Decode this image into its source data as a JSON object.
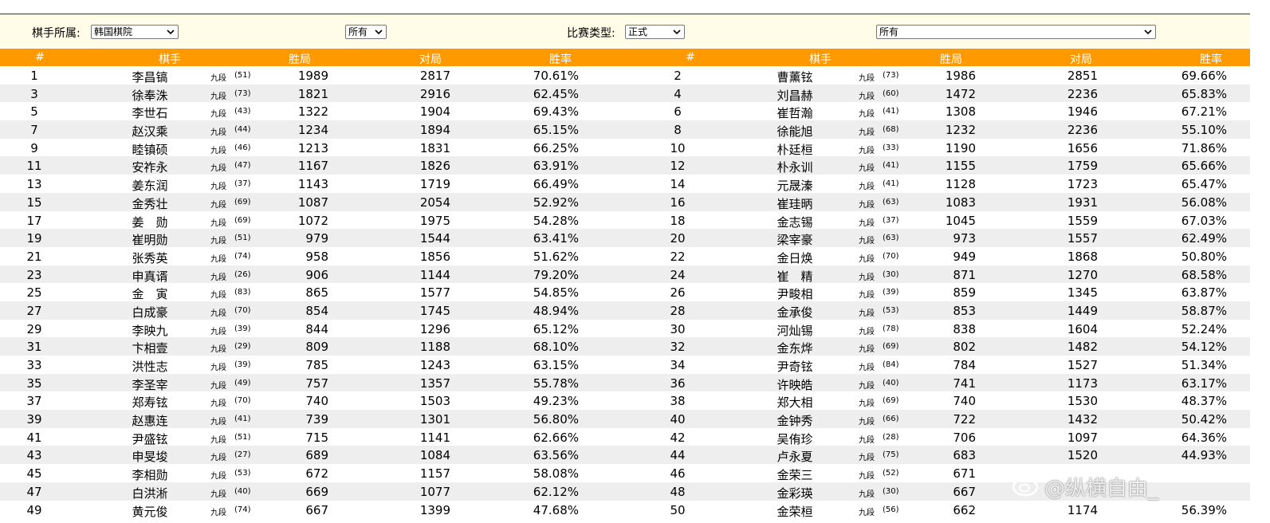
{
  "filters": {
    "affiliation_label": "棋手所属:",
    "affiliation_value": "韩国棋院",
    "second_value": "所有",
    "match_type_label": "比赛类型:",
    "match_type_value": "正式",
    "fourth_value": "所有"
  },
  "columns": [
    "#",
    "棋手",
    "胜局",
    "对局",
    "胜率"
  ],
  "players": [
    {
      "n": "1",
      "name": "李昌镐",
      "rank": "九段",
      "games": "(51)",
      "wins": "1989",
      "total": "2817",
      "rate": "70.61%"
    },
    {
      "n": "2",
      "name": "曹薰铉",
      "rank": "九段",
      "games": "(73)",
      "wins": "1986",
      "total": "2851",
      "rate": "69.66%"
    },
    {
      "n": "3",
      "name": "徐奉洙",
      "rank": "九段",
      "games": "(73)",
      "wins": "1821",
      "total": "2916",
      "rate": "62.45%"
    },
    {
      "n": "4",
      "name": "刘昌赫",
      "rank": "九段",
      "games": "(60)",
      "wins": "1472",
      "total": "2236",
      "rate": "65.83%"
    },
    {
      "n": "5",
      "name": "李世石",
      "rank": "九段",
      "games": "(43)",
      "wins": "1322",
      "total": "1904",
      "rate": "69.43%"
    },
    {
      "n": "6",
      "name": "崔哲瀚",
      "rank": "九段",
      "games": "(41)",
      "wins": "1308",
      "total": "1946",
      "rate": "67.21%"
    },
    {
      "n": "7",
      "name": "赵汉乘",
      "rank": "九段",
      "games": "(44)",
      "wins": "1234",
      "total": "1894",
      "rate": "65.15%"
    },
    {
      "n": "8",
      "name": "徐能旭",
      "rank": "九段",
      "games": "(68)",
      "wins": "1232",
      "total": "2236",
      "rate": "55.10%"
    },
    {
      "n": "9",
      "name": "睦镇硕",
      "rank": "九段",
      "games": "(46)",
      "wins": "1213",
      "total": "1831",
      "rate": "66.25%"
    },
    {
      "n": "10",
      "name": "朴廷桓",
      "rank": "九段",
      "games": "(33)",
      "wins": "1190",
      "total": "1656",
      "rate": "71.86%"
    },
    {
      "n": "11",
      "name": "安祚永",
      "rank": "九段",
      "games": "(47)",
      "wins": "1167",
      "total": "1826",
      "rate": "63.91%"
    },
    {
      "n": "12",
      "name": "朴永训",
      "rank": "九段",
      "games": "(41)",
      "wins": "1155",
      "total": "1759",
      "rate": "65.66%"
    },
    {
      "n": "13",
      "name": "姜东润",
      "rank": "九段",
      "games": "(37)",
      "wins": "1143",
      "total": "1719",
      "rate": "66.49%"
    },
    {
      "n": "14",
      "name": "元晟溱",
      "rank": "九段",
      "games": "(41)",
      "wins": "1128",
      "total": "1723",
      "rate": "65.47%"
    },
    {
      "n": "15",
      "name": "金秀壮",
      "rank": "九段",
      "games": "(69)",
      "wins": "1087",
      "total": "2054",
      "rate": "52.92%"
    },
    {
      "n": "16",
      "name": "崔珪昞",
      "rank": "九段",
      "games": "(63)",
      "wins": "1083",
      "total": "1931",
      "rate": "56.08%"
    },
    {
      "n": "17",
      "name": "姜　勋",
      "rank": "九段",
      "games": "(69)",
      "wins": "1072",
      "total": "1975",
      "rate": "54.28%"
    },
    {
      "n": "18",
      "name": "金志锡",
      "rank": "九段",
      "games": "(37)",
      "wins": "1045",
      "total": "1559",
      "rate": "67.03%"
    },
    {
      "n": "19",
      "name": "崔明勋",
      "rank": "九段",
      "games": "(51)",
      "wins": "979",
      "total": "1544",
      "rate": "63.41%"
    },
    {
      "n": "20",
      "name": "梁宰豪",
      "rank": "九段",
      "games": "(63)",
      "wins": "973",
      "total": "1557",
      "rate": "62.49%"
    },
    {
      "n": "21",
      "name": "张秀英",
      "rank": "九段",
      "games": "(74)",
      "wins": "958",
      "total": "1856",
      "rate": "51.62%"
    },
    {
      "n": "22",
      "name": "金日焕",
      "rank": "九段",
      "games": "(70)",
      "wins": "949",
      "total": "1868",
      "rate": "50.80%"
    },
    {
      "n": "23",
      "name": "申真谞",
      "rank": "九段",
      "games": "(26)",
      "wins": "906",
      "total": "1144",
      "rate": "79.20%"
    },
    {
      "n": "24",
      "name": "崔　精",
      "rank": "九段",
      "games": "(30)",
      "wins": "871",
      "total": "1270",
      "rate": "68.58%"
    },
    {
      "n": "25",
      "name": "金　寅",
      "rank": "九段",
      "games": "(83)",
      "wins": "865",
      "total": "1577",
      "rate": "54.85%"
    },
    {
      "n": "26",
      "name": "尹畯相",
      "rank": "九段",
      "games": "(39)",
      "wins": "859",
      "total": "1345",
      "rate": "63.87%"
    },
    {
      "n": "27",
      "name": "白成豪",
      "rank": "九段",
      "games": "(70)",
      "wins": "854",
      "total": "1745",
      "rate": "48.94%"
    },
    {
      "n": "28",
      "name": "金承俊",
      "rank": "九段",
      "games": "(53)",
      "wins": "853",
      "total": "1449",
      "rate": "58.87%"
    },
    {
      "n": "29",
      "name": "李映九",
      "rank": "九段",
      "games": "(39)",
      "wins": "844",
      "total": "1296",
      "rate": "65.12%"
    },
    {
      "n": "30",
      "name": "河灿锡",
      "rank": "九段",
      "games": "(78)",
      "wins": "838",
      "total": "1604",
      "rate": "52.24%"
    },
    {
      "n": "31",
      "name": "卞相壹",
      "rank": "九段",
      "games": "(29)",
      "wins": "809",
      "total": "1188",
      "rate": "68.10%"
    },
    {
      "n": "32",
      "name": "金东烨",
      "rank": "九段",
      "games": "(69)",
      "wins": "802",
      "total": "1482",
      "rate": "54.12%"
    },
    {
      "n": "33",
      "name": "洪性志",
      "rank": "九段",
      "games": "(39)",
      "wins": "785",
      "total": "1243",
      "rate": "63.15%"
    },
    {
      "n": "34",
      "name": "尹奇铉",
      "rank": "九段",
      "games": "(84)",
      "wins": "784",
      "total": "1527",
      "rate": "51.34%"
    },
    {
      "n": "35",
      "name": "李圣宰",
      "rank": "九段",
      "games": "(49)",
      "wins": "757",
      "total": "1357",
      "rate": "55.78%"
    },
    {
      "n": "36",
      "name": "许映皓",
      "rank": "九段",
      "games": "(40)",
      "wins": "741",
      "total": "1173",
      "rate": "63.17%"
    },
    {
      "n": "37",
      "name": "郑寿铉",
      "rank": "九段",
      "games": "(70)",
      "wins": "740",
      "total": "1503",
      "rate": "49.23%"
    },
    {
      "n": "38",
      "name": "郑大相",
      "rank": "九段",
      "games": "(69)",
      "wins": "740",
      "total": "1530",
      "rate": "48.37%"
    },
    {
      "n": "39",
      "name": "赵惠连",
      "rank": "九段",
      "games": "(41)",
      "wins": "739",
      "total": "1301",
      "rate": "56.80%"
    },
    {
      "n": "40",
      "name": "金钟秀",
      "rank": "九段",
      "games": "(66)",
      "wins": "722",
      "total": "1432",
      "rate": "50.42%"
    },
    {
      "n": "41",
      "name": "尹盛铉",
      "rank": "九段",
      "games": "(51)",
      "wins": "715",
      "total": "1141",
      "rate": "62.66%"
    },
    {
      "n": "42",
      "name": "吴侑珍",
      "rank": "九段",
      "games": "(28)",
      "wins": "706",
      "total": "1097",
      "rate": "64.36%"
    },
    {
      "n": "43",
      "name": "申旻埈",
      "rank": "九段",
      "games": "(27)",
      "wins": "689",
      "total": "1084",
      "rate": "63.56%"
    },
    {
      "n": "44",
      "name": "卢永夏",
      "rank": "九段",
      "games": "(75)",
      "wins": "683",
      "total": "1520",
      "rate": "44.93%"
    },
    {
      "n": "45",
      "name": "李相勋",
      "rank": "九段",
      "games": "(53)",
      "wins": "672",
      "total": "1157",
      "rate": "58.08%"
    },
    {
      "n": "46",
      "name": "金荣三",
      "rank": "九段",
      "games": "(52)",
      "wins": "671",
      "total": "",
      "rate": ""
    },
    {
      "n": "47",
      "name": "白洪淅",
      "rank": "九段",
      "games": "(40)",
      "wins": "669",
      "total": "1077",
      "rate": "62.12%"
    },
    {
      "n": "48",
      "name": "金彩瑛",
      "rank": "九段",
      "games": "(30)",
      "wins": "667",
      "total": "",
      "rate": ""
    },
    {
      "n": "49",
      "name": "黄元俊",
      "rank": "九段",
      "games": "(74)",
      "wins": "667",
      "total": "1399",
      "rate": "47.68%"
    },
    {
      "n": "50",
      "name": "金荣桓",
      "rank": "九段",
      "games": "(56)",
      "wins": "662",
      "total": "1174",
      "rate": "56.39%"
    }
  ],
  "watermark": "@纵横自由_",
  "colors": {
    "header_bg": "#ff9900",
    "filter_bg": "#fffde7",
    "alt_row": "#eeeeee"
  }
}
